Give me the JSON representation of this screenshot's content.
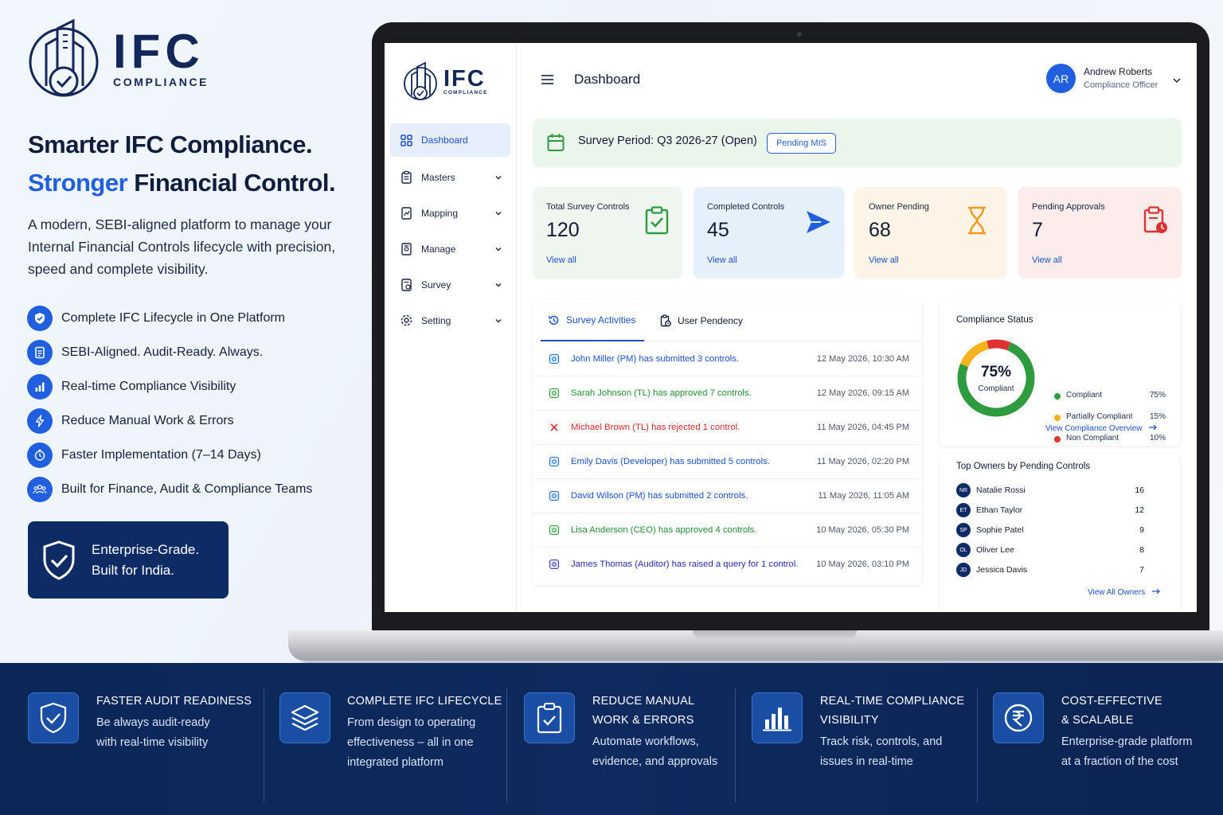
{
  "brand": {
    "name": "IFC",
    "subtitle": "COMPLIANCE"
  },
  "hero": {
    "headline_line1": "Smarter IFC Compliance.",
    "headline_line2_blue": "Stronger",
    "headline_line2_rest": " Financial Control.",
    "description": "A modern, SEBI-aligned platform to manage your Internal Financial Controls lifecycle with precision, speed and complete visibility.",
    "features": [
      "Complete IFC Lifecycle in One Platform",
      "SEBI-Aligned. Audit-Ready. Always.",
      "Real-time Compliance Visibility",
      "Reduce Manual Work & Errors",
      "Faster Implementation (7–14 Days)",
      "Built for Finance, Audit & Compliance Teams"
    ],
    "enterprise_line1": "Enterprise-Grade.",
    "enterprise_line2": "Built for India."
  },
  "app": {
    "logo_name": "IFC",
    "logo_sub": "COMPLIANCE",
    "nav": [
      {
        "label": "Dashboard",
        "icon": "grid-icon",
        "active": true
      },
      {
        "label": "Masters",
        "icon": "clipboard-icon"
      },
      {
        "label": "Mapping",
        "icon": "map-doc-icon"
      },
      {
        "label": "Manage",
        "icon": "manage-doc-icon"
      },
      {
        "label": "Survey",
        "icon": "survey-doc-icon"
      },
      {
        "label": "Setting",
        "icon": "gear-icon"
      }
    ],
    "page_title": "Dashboard",
    "user": {
      "initials": "AR",
      "name": "Andrew Roberts",
      "role": "Compliance Officer"
    },
    "survey_period": "Survey Period: Q3 2026-27 (Open)",
    "pending_mis": "Pending MIS",
    "cards": [
      {
        "label": "Total Survey Controls",
        "value": "120",
        "link": "View all",
        "bg": "#eef6ef",
        "icon_color": "#2e9b3e"
      },
      {
        "label": "Completed Controls",
        "value": "45",
        "link": "View all",
        "bg": "#e6f0fb",
        "icon_color": "#1f5fe0"
      },
      {
        "label": "Owner Pending",
        "value": "68",
        "link": "View all",
        "bg": "#fdf3e7",
        "icon_color": "#f39a1c"
      },
      {
        "label": "Pending Approvals",
        "value": "7",
        "link": "View all",
        "bg": "#fdecec",
        "icon_color": "#e03131"
      }
    ],
    "tabs": {
      "activities": "Survey Activities",
      "pendency": "User Pendency"
    },
    "activities": [
      {
        "text": "John Miller (PM) has submitted 3 controls.",
        "time": "12 May 2026, 10:30 AM",
        "color": "#1f4fc7",
        "accent": "#1f6fd8"
      },
      {
        "text": "Sarah Johnson (TL) has approved 7 controls.",
        "time": "12 May 2026, 09:15 AM",
        "color": "#2a8a3a",
        "accent": "#2e9b3e"
      },
      {
        "text": "Michael Brown (TL) has rejected 1 control.",
        "time": "11 May 2026, 04:45 PM",
        "color": "#d12a2a",
        "accent": "#e03131"
      },
      {
        "text": "Emily Davis (Developer) has submitted 5 controls.",
        "time": "11 May 2026, 02:20 PM",
        "color": "#1f4fc7",
        "accent": "#1f6fd8"
      },
      {
        "text": "David Wilson (PM) has submitted 2 controls.",
        "time": "11 May 2026, 11:05 AM",
        "color": "#1f4fc7",
        "accent": "#1f6fd8"
      },
      {
        "text": "Lisa Anderson (CEO) has approved 4 controls.",
        "time": "10 May 2026, 05:30 PM",
        "color": "#2a8a3a",
        "accent": "#2e9b3e"
      },
      {
        "text": "James Thomas (Auditor) has raised a query for 1 control.",
        "time": "10 May 2026, 03:10 PM",
        "color": "#2a2aa8",
        "accent": "#3b3bc4"
      }
    ],
    "compliance": {
      "title": "Compliance Status",
      "center_value": "75%",
      "center_label": "Compliant",
      "segments": [
        {
          "name": "Compliant",
          "pct_label": "75%",
          "value": 75,
          "color": "#2e9b3e"
        },
        {
          "name": "Partially Compliant",
          "pct_label": "15%",
          "value": 15,
          "color": "#f5b21c"
        },
        {
          "name": "Non Compliant",
          "pct_label": "10%",
          "value": 10,
          "color": "#e03131"
        }
      ],
      "link": "View Compliance Overview"
    },
    "owners": {
      "title": "Top Owners by Pending Controls",
      "rows": [
        {
          "initials": "NR",
          "name": "Natalie Rossi",
          "count": "16"
        },
        {
          "initials": "ET",
          "name": "Ethan Taylor",
          "count": "12"
        },
        {
          "initials": "SP",
          "name": "Sophie Patel",
          "count": "9"
        },
        {
          "initials": "OL",
          "name": "Oliver Lee",
          "count": "8"
        },
        {
          "initials": "JD",
          "name": "Jessica Davis",
          "count": "7"
        }
      ],
      "link": "View All Owners"
    }
  },
  "footer": [
    {
      "title_lines": [
        "FASTER AUDIT READINESS"
      ],
      "body_lines": [
        "Be always audit-ready",
        "with real-time visibility"
      ],
      "icon": "shield-check-icon"
    },
    {
      "title_lines": [
        "COMPLETE IFC LIFECYCLE"
      ],
      "body_lines": [
        "From design to operating",
        "effectiveness – all in one",
        "integrated platform"
      ],
      "icon": "layers-icon"
    },
    {
      "title_lines": [
        "REDUCE MANUAL",
        "WORK & ERRORS"
      ],
      "body_lines": [
        "Automate workflows,",
        "evidence, and approvals"
      ],
      "icon": "clipboard-check-icon"
    },
    {
      "title_lines": [
        "REAL-TIME COMPLIANCE",
        "VISIBILITY"
      ],
      "body_lines": [
        "Track risk, controls, and",
        "issues in real-time"
      ],
      "icon": "bar-chart-icon"
    },
    {
      "title_lines": [
        "COST-EFFECTIVE",
        "& SCALABLE"
      ],
      "body_lines": [
        "Enterprise-grade platform",
        "at a fraction of the cost"
      ],
      "icon": "rupee-icon"
    }
  ]
}
